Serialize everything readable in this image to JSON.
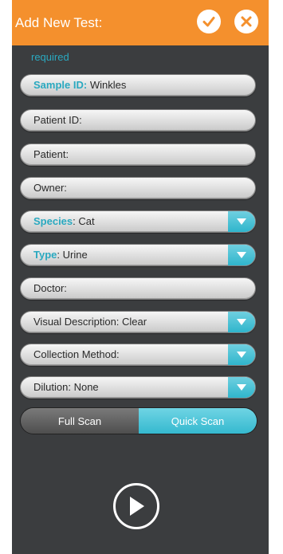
{
  "header": {
    "title": "Add New Test:",
    "confirm_icon": "check-icon",
    "close_icon": "close-icon",
    "color": "#f4902d"
  },
  "required_label": "required",
  "fields": {
    "sample_id": {
      "label": "Sample ID:",
      "value": "Winkles"
    },
    "patient_id": {
      "label": "Patient ID:"
    },
    "patient": {
      "label": "Patient:"
    },
    "owner": {
      "label": "Owner:"
    },
    "species": {
      "label": "Species",
      "value": ": Cat"
    },
    "type": {
      "label": "Type",
      "value": ": Urine"
    },
    "doctor": {
      "label": "Doctor:"
    },
    "visual_description": {
      "label": "Visual Description: Clear"
    },
    "collection_method": {
      "label": "Collection Method:"
    },
    "dilution": {
      "label": "Dilution: None"
    }
  },
  "scan_mode": {
    "options": [
      "Full Scan",
      "Quick Scan"
    ],
    "selected": "Quick Scan"
  },
  "play_icon": "play-icon",
  "colors": {
    "accent": "#2aa9c0",
    "panel": "#3b3d3f"
  }
}
